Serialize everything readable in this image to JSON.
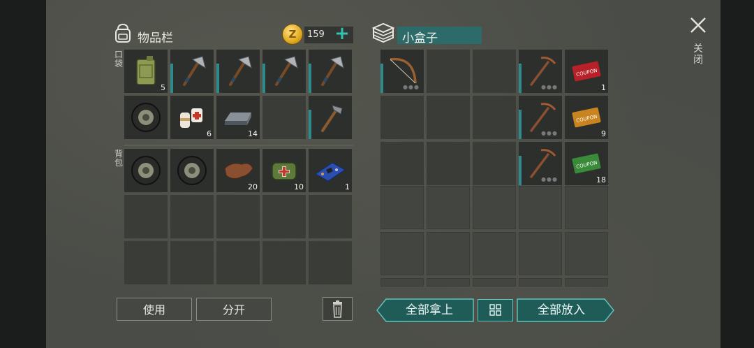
{
  "close": {
    "label": "关闭",
    "icon": "close-icon"
  },
  "inventory": {
    "title": "物品栏",
    "coins": "159",
    "pocket_label": "口袋",
    "backpack_label": "背包",
    "pocket": [
      {
        "item": "jerrycan",
        "count": "5",
        "accent": false
      },
      {
        "item": "hatchet",
        "count": "",
        "accent": true
      },
      {
        "item": "hatchet",
        "count": "",
        "accent": true
      },
      {
        "item": "hatchet",
        "count": "",
        "accent": true
      },
      {
        "item": "hatchet",
        "count": "",
        "accent": true
      },
      {
        "item": "tire",
        "count": "",
        "accent": false
      },
      {
        "item": "bandage",
        "count": "6",
        "accent": false
      },
      {
        "item": "metal-bar",
        "count": "14",
        "accent": false
      },
      {
        "item": "",
        "count": "",
        "accent": false
      },
      {
        "item": "crude-hammer",
        "count": "",
        "accent": true
      }
    ],
    "backpack": [
      {
        "item": "tire",
        "count": ""
      },
      {
        "item": "tire",
        "count": ""
      },
      {
        "item": "leather",
        "count": "20"
      },
      {
        "item": "medkit-bag",
        "count": "10"
      },
      {
        "item": "circuit-board",
        "count": "1"
      },
      {
        "item": "",
        "count": ""
      },
      {
        "item": "",
        "count": ""
      },
      {
        "item": "",
        "count": ""
      },
      {
        "item": "",
        "count": ""
      },
      {
        "item": "",
        "count": ""
      },
      {
        "item": "",
        "count": ""
      },
      {
        "item": "",
        "count": ""
      },
      {
        "item": "",
        "count": ""
      },
      {
        "item": "",
        "count": ""
      },
      {
        "item": "",
        "count": ""
      }
    ],
    "use_label": "使用",
    "split_label": "分开"
  },
  "box": {
    "title": "小盒子",
    "cells": [
      {
        "item": "bow",
        "count": "",
        "accent": true,
        "dots": true
      },
      {
        "item": "",
        "count": ""
      },
      {
        "item": "",
        "count": ""
      },
      {
        "item": "pickaxe",
        "count": "",
        "accent": true,
        "dots": true
      },
      {
        "item": "coupon-red",
        "count": "1"
      },
      {
        "item": "",
        "count": ""
      },
      {
        "item": "",
        "count": ""
      },
      {
        "item": "",
        "count": ""
      },
      {
        "item": "pickaxe",
        "count": "",
        "accent": true,
        "dots": true
      },
      {
        "item": "coupon-orange",
        "count": "9"
      },
      {
        "item": "",
        "count": ""
      },
      {
        "item": "",
        "count": ""
      },
      {
        "item": "",
        "count": ""
      },
      {
        "item": "pickaxe",
        "count": "",
        "accent": true,
        "dots": true
      },
      {
        "item": "coupon-green",
        "count": "18"
      }
    ],
    "take_all_label": "全部拿上",
    "put_all_label": "全部放入"
  }
}
